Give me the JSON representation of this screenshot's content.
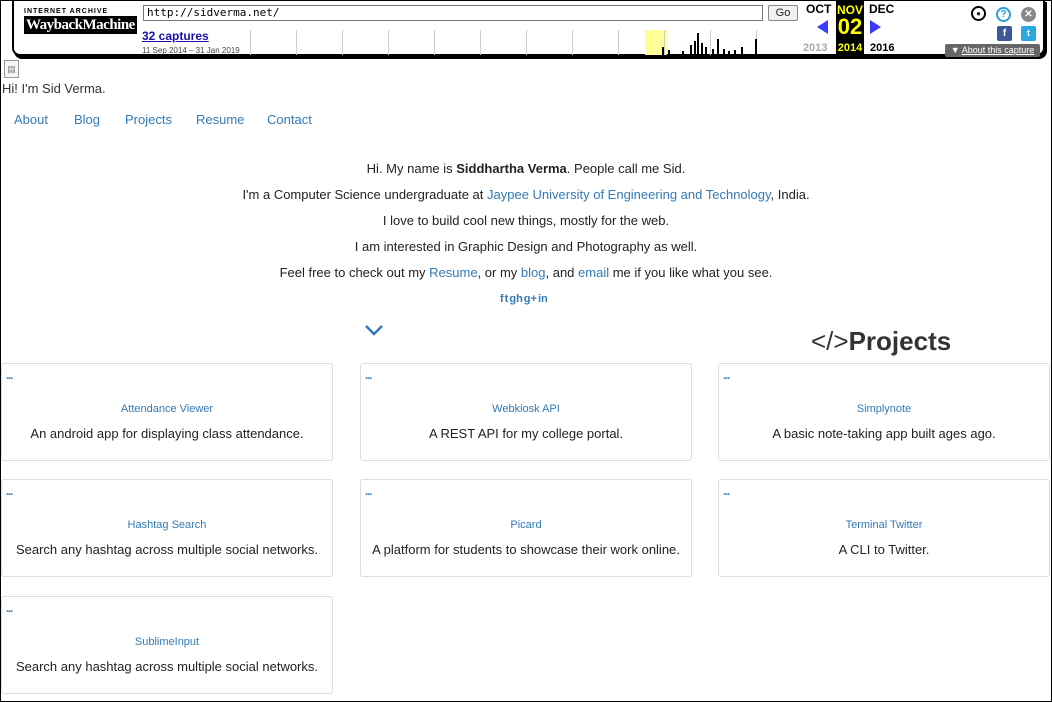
{
  "wayback": {
    "logo_top": "INTERNET ARCHIVE",
    "logo_way": "Wayback",
    "logo_machine": "Machine",
    "url": "http://sidverma.net/",
    "go_label": "Go",
    "captures": "32 captures",
    "range": "11 Sep 2014 – 31 Jan 2019",
    "prev_month": "OCT",
    "cur_month": "NOV",
    "next_month": "DEC",
    "cur_day": "02",
    "prev_year": "2013",
    "cur_year": "2014",
    "next_year": "2016",
    "about_capture": "About this capture"
  },
  "page": {
    "greeting": "Hi! I'm Sid Verma.",
    "nav": [
      "About",
      "Blog",
      "Projects",
      "Resume",
      "Contact"
    ],
    "intro": {
      "l1_pre": "Hi. My name is ",
      "l1_name": "Siddhartha Verma",
      "l1_post": ". People call me Sid.",
      "l2_pre": "I'm a Computer Science undergraduate at ",
      "l2_link": "Jaypee University of Engineering and Technology",
      "l2_post": ", India.",
      "l3": "I love to build cool new things, mostly for the web.",
      "l4": "I am interested in Graphic Design and Photography as well.",
      "l5_a": "Feel free to check out my ",
      "l5_resume": "Resume",
      "l5_b": ", or my ",
      "l5_blog": "blog",
      "l5_c": ", and ",
      "l5_email": "email",
      "l5_d": " me if you like what you see."
    },
    "social": [
      "f",
      "t",
      "gh",
      "g+",
      "in"
    ],
    "projects_heading_code": "</>",
    "projects_heading": "Projects",
    "card_dots": "...",
    "projects": [
      {
        "name": "Attendance Viewer",
        "desc": "An android app for displaying class attendance."
      },
      {
        "name": "Webkiosk API",
        "desc": "A REST API for my college portal."
      },
      {
        "name": "Simplynote",
        "desc": "A basic note-taking app built ages ago."
      },
      {
        "name": "Hashtag Search",
        "desc": "Search any hashtag across multiple social networks."
      },
      {
        "name": "Picard",
        "desc": "A platform for students to showcase their work online."
      },
      {
        "name": "Terminal Twitter",
        "desc": "A CLI to Twitter."
      },
      {
        "name": "SublimeInput",
        "desc": "Search any hashtag across multiple social networks."
      }
    ]
  },
  "colors": {
    "link": "#337ab7",
    "wayback_highlight": "#ffff00"
  }
}
